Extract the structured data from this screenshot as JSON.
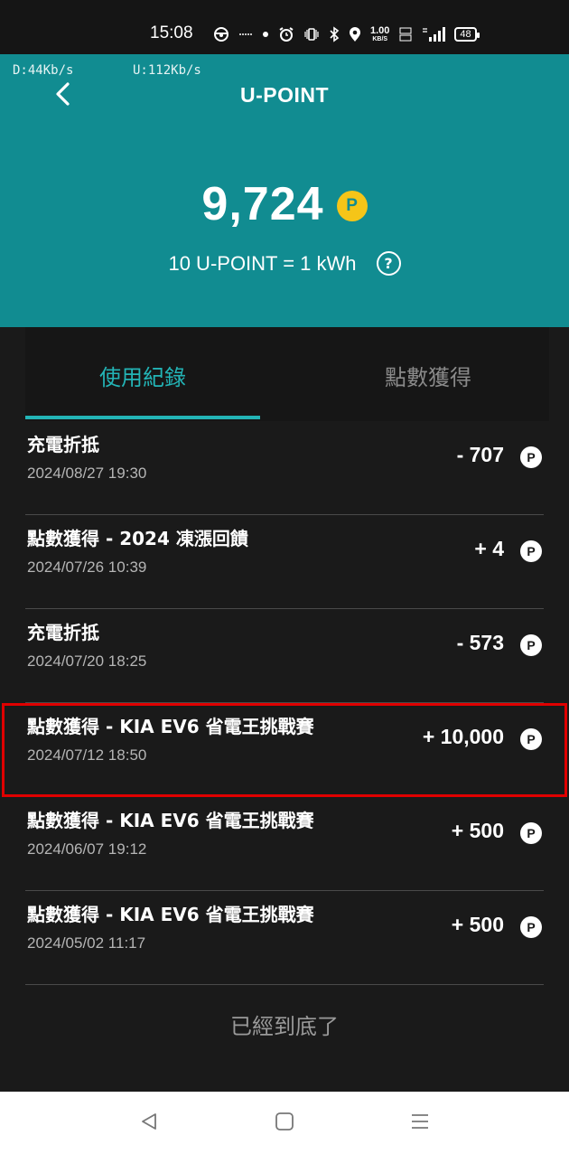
{
  "status_bar": {
    "time": "15:08",
    "net_speed_top": "1.00",
    "net_speed_unit": "KB/S",
    "battery": "48"
  },
  "overlay": {
    "download": "D:44Kb/s",
    "upload": "U:112Kb/s"
  },
  "header": {
    "title": "U-POINT",
    "points": "9,724",
    "coin_symbol": "P",
    "rate_text": "10 U-POINT = 1 kWh",
    "help_symbol": "?"
  },
  "tabs": [
    {
      "label": "使用紀錄",
      "active": true
    },
    {
      "label": "點數獲得",
      "active": false
    }
  ],
  "records": [
    {
      "title": "充電折抵",
      "date": "2024/08/27 19:30",
      "amount": "- 707",
      "coin": "P"
    },
    {
      "title": "點數獲得 - 2024 凍漲回饋",
      "date": "2024/07/26 10:39",
      "amount": "+ 4",
      "coin": "P"
    },
    {
      "title": "充電折抵",
      "date": "2024/07/20 18:25",
      "amount": "- 573",
      "coin": "P"
    },
    {
      "title": "點數獲得 - KIA EV6 省電王挑戰賽",
      "date": "2024/07/12 18:50",
      "amount": "+ 10,000",
      "coin": "P"
    },
    {
      "title": "點數獲得 - KIA EV6 省電王挑戰賽",
      "date": "2024/06/07 19:12",
      "amount": "+ 500",
      "coin": "P"
    },
    {
      "title": "點數獲得 - KIA EV6 省電王挑戰賽",
      "date": "2024/05/02 11:17",
      "amount": "+ 500",
      "coin": "P"
    }
  ],
  "end_note": "已經到底了",
  "colors": {
    "header_bg": "#118c91",
    "accent": "#23b4b6",
    "coin_yellow": "#f5c518",
    "highlight_red": "#e00000",
    "list_bg": "#1a1a1a"
  },
  "icons": {
    "back": "chevron-left-icon",
    "help": "help-circle-icon",
    "nav_back": "triangle-back-icon",
    "nav_home": "square-home-icon",
    "nav_menu": "menu-lines-icon"
  }
}
